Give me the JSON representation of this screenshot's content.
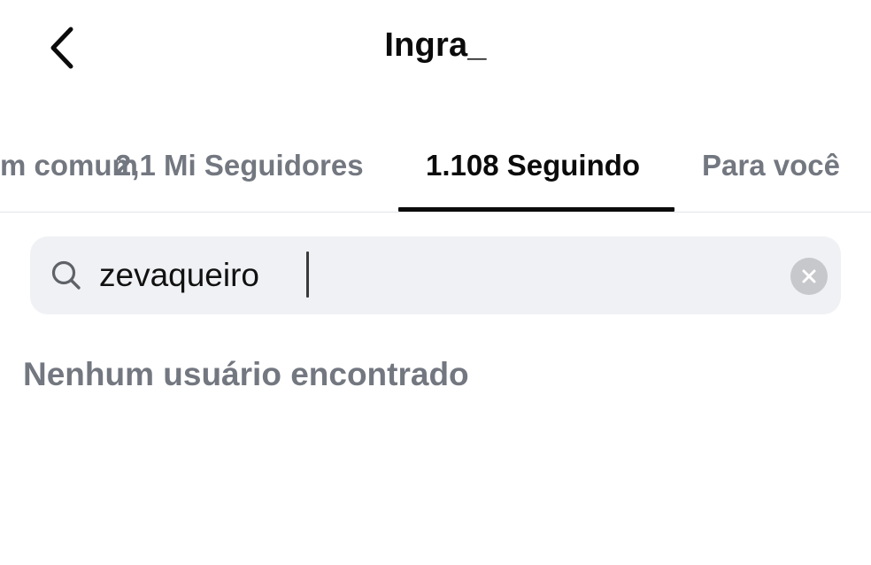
{
  "header": {
    "title": "Ingra_",
    "back_icon": "chevron-left-icon"
  },
  "tabs": [
    {
      "label": "Em comum",
      "active": false
    },
    {
      "label": "2,1 Mi Seguidores",
      "active": false
    },
    {
      "label": "1.108 Seguindo",
      "active": true
    },
    {
      "label": "Para você",
      "active": false
    }
  ],
  "search": {
    "icon": "search-icon",
    "value": "zevaqueiro",
    "clear_icon": "clear-icon"
  },
  "results": {
    "empty_message": "Nenhum usuário encontrado"
  },
  "colors": {
    "text_primary": "#0b0b0b",
    "text_secondary": "#737780",
    "search_bg": "#f0f1f4",
    "clear_bg": "#c7c8cc",
    "divider": "#e3e4e8"
  }
}
